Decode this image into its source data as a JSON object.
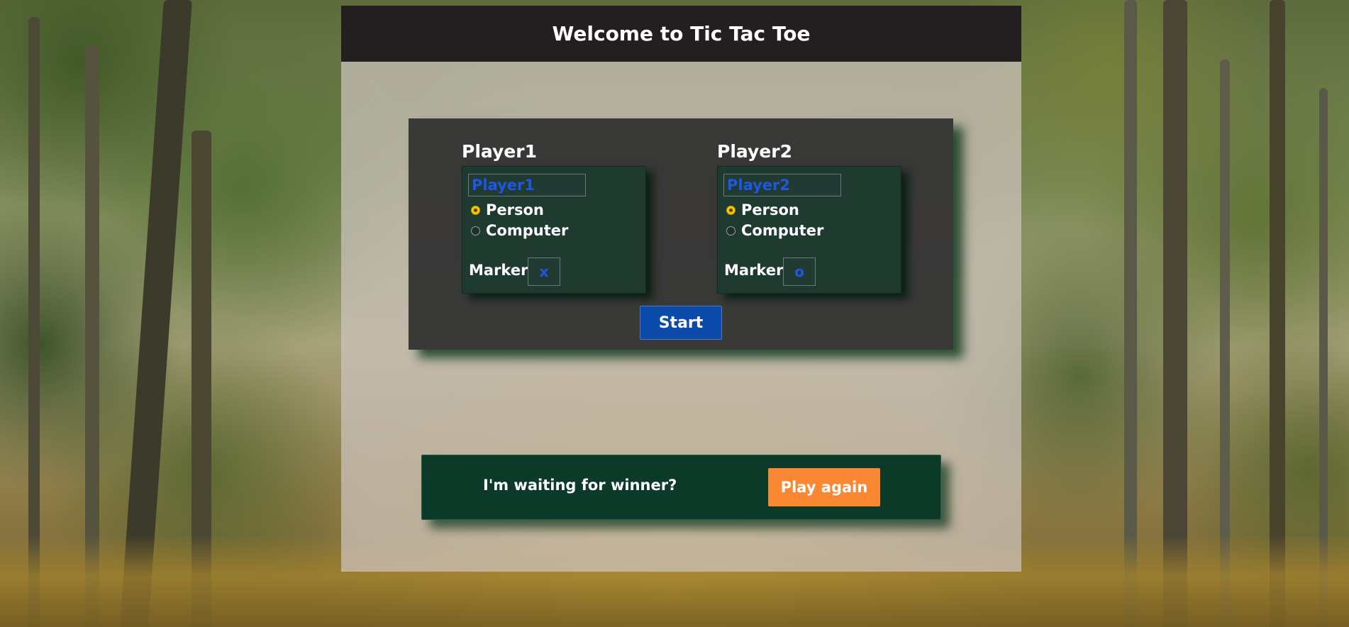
{
  "header": {
    "title": "Welcome to Tic Tac Toe"
  },
  "players": [
    {
      "title": "Player1",
      "name_value": "Player1",
      "options": [
        "Person",
        "Computer"
      ],
      "selected": "Person",
      "marker_label": "Marker",
      "marker_value": "x"
    },
    {
      "title": "Player2",
      "name_value": "Player2",
      "options": [
        "Person",
        "Computer"
      ],
      "selected": "Person",
      "marker_label": "Marker",
      "marker_value": "o"
    }
  ],
  "start_label": "Start",
  "result": {
    "message": "I'm waiting for winner?",
    "play_again_label": "Play again"
  },
  "colors": {
    "header_bg": "#231f20",
    "start_bg": "#0b4aa8",
    "play_again_bg": "#fa8833",
    "result_bg": "#0c3a28",
    "input_text": "#1e58e0"
  }
}
